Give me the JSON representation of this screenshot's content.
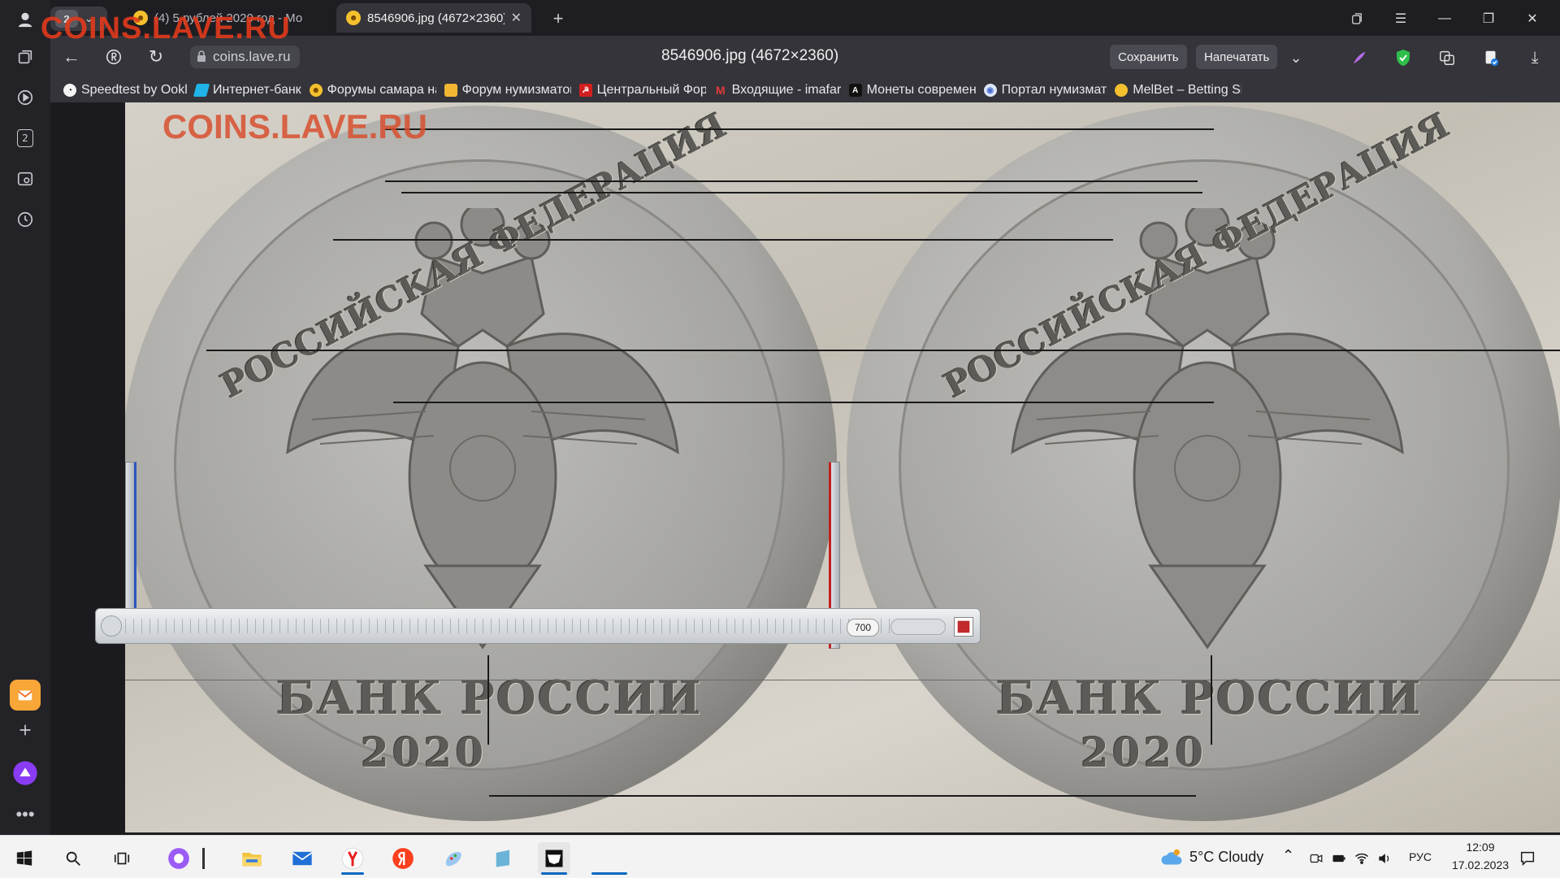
{
  "sidebar": {
    "tabs_count_badge": "2"
  },
  "tabs": {
    "group_count": "2",
    "items": [
      {
        "label": "(4) 5 рублей 2020 год - Мо",
        "active": false
      },
      {
        "label": "8546906.jpg (4672×2360)",
        "active": true
      }
    ]
  },
  "address": {
    "url": "coins.lave.ru",
    "page_title": "8546906.jpg (4672×2360)",
    "save_label": "Сохранить",
    "print_label": "Напечатать"
  },
  "bookmarks": [
    {
      "label": "Speedtest by Ookla",
      "icon": "speedtest-icon",
      "color": "#1a1a1a"
    },
    {
      "label": "Интернет-банк",
      "icon": "bank-icon",
      "color": "#1fb3e8"
    },
    {
      "label": "Форумы самара на",
      "icon": "smiley-icon",
      "color": "#f4c02d"
    },
    {
      "label": "Форум нумизматов",
      "icon": "thumb-icon",
      "color": "#f2b632"
    },
    {
      "label": "Центральный Фор",
      "icon": "sickle-icon",
      "color": "#d21f1f"
    },
    {
      "label": "Входящие - imafar",
      "icon": "mail-icon",
      "color": "#e03a3a"
    },
    {
      "label": "Монеты современ",
      "icon": "letter-a-icon",
      "color": "#111111"
    },
    {
      "label": "Портал нумизмат",
      "icon": "coin-icon",
      "color": "#4a6fd0"
    },
    {
      "label": "MelBet – Betting Sit",
      "icon": "melbet-icon",
      "color": "#f4c02d"
    }
  ],
  "watermark": "COINS.LAVE.RU",
  "coin": {
    "top_legend": "РОССИЙСКАЯ ФЕДЕРАЦИЯ",
    "bottom_legend": "БАНК РОССИИ",
    "year": "2020"
  },
  "caliper": {
    "readout": "700"
  },
  "taskbar": {
    "weather": "5°C  Cloudy",
    "lang": "РУС",
    "time": "12:09",
    "date": "17.02.2023"
  }
}
